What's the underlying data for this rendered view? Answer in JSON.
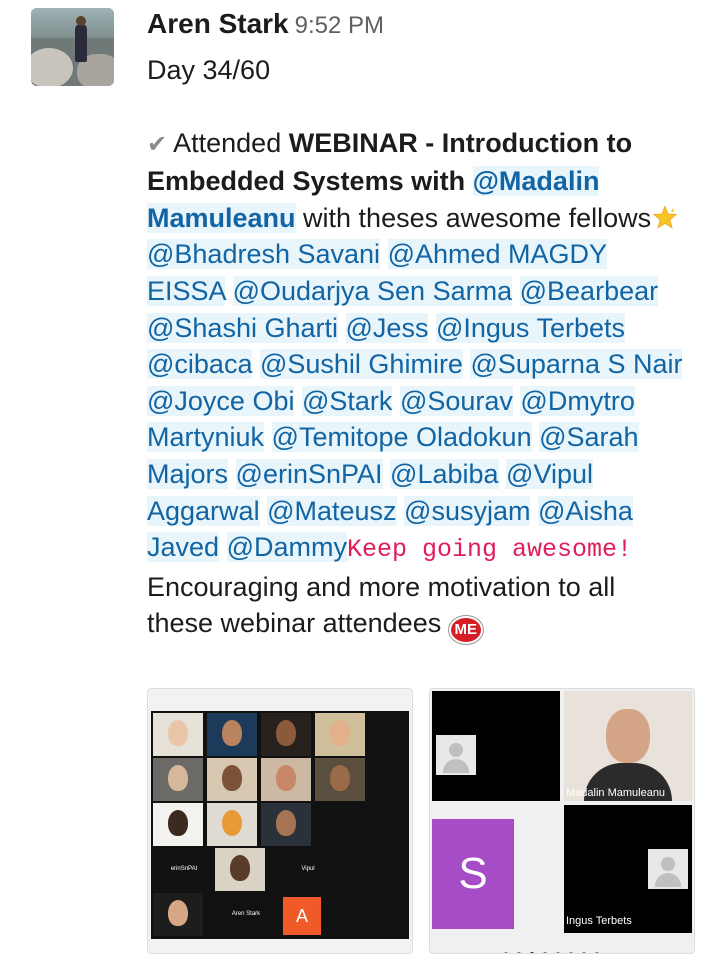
{
  "author": "Aren Stark",
  "time": "9:52 PM",
  "lines": {
    "day": "Day 34/60",
    "attended": "Attended ",
    "webinar": "WEBINAR - Introduction to Embedded Systems with ",
    "host": "@Madalin Mamuleanu",
    "with": " with theses awesome fellows",
    "mentions": [
      "@Bhadresh Savani",
      "@Ahmed MAGDY EISSA",
      "@Oudarjya Sen Sarma",
      "@Bearbear",
      "@Shashi Gharti",
      "@Jess",
      "@Ingus Terbets",
      "@cibaca",
      "@Sushil Ghimire",
      "@Suparna S Nair",
      "@Joyce Obi",
      "@Stark",
      "@Sourav",
      "@Dmytro Martyniuk",
      "@Temitope Oladokun",
      "@Sarah Majors",
      "@erinSnPAI",
      "@Labiba",
      "@Vipul Aggarwal",
      "@Mateusz",
      "@susyjam",
      "@Aisha Javed",
      "@Dammy"
    ],
    "code": "Keep going awesome!",
    "closing": "Encouraging and more motivation to all these webinar attendees"
  },
  "icons": {
    "check": "heavy-check-mark",
    "star": "glowing-star",
    "badge": "me-badge"
  },
  "badge_text": "ME",
  "image1": {
    "tiles": {
      "erin": "erinSnPAI",
      "vipul": "Vipul",
      "aren": "Aren Stark",
      "a": "A"
    }
  },
  "image2": {
    "host_label": "Madalin Mamuleanu",
    "ingus_label": "Ingus Terbets",
    "s_letter": "S"
  },
  "colors": {
    "mention": "#1264a3",
    "mention_bg": "#e8f5fa",
    "code": "#e01e5a",
    "tile_a": "#f05a28",
    "tile_s": "#a64cc6"
  }
}
